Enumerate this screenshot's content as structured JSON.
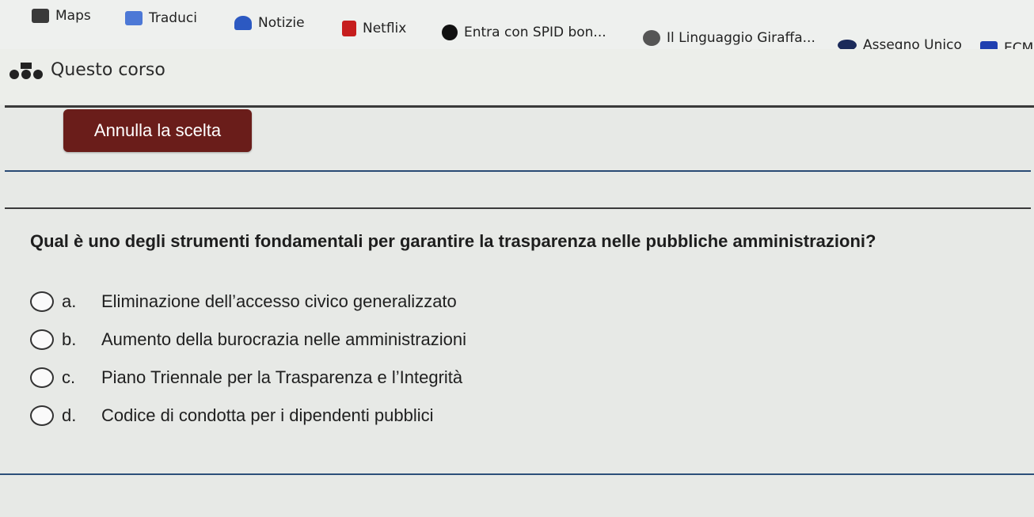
{
  "bookmarks": [
    {
      "label": "Maps",
      "icon": "maps-icon",
      "color": "#3a3a3a"
    },
    {
      "label": "Traduci",
      "icon": "translate-icon",
      "color": "#4c78d6"
    },
    {
      "label": "Notizie",
      "icon": "news-icon",
      "color": "#2c59c2"
    },
    {
      "label": "Netflix",
      "icon": "netflix-icon",
      "color": "#c61d1d"
    },
    {
      "label": "Entra con SPID bon...",
      "icon": "spid-icon",
      "color": "#111111"
    },
    {
      "label": "Il Linguaggio Giraffa...",
      "icon": "giraffe-icon",
      "color": "#555555"
    },
    {
      "label": "Assegno Unico",
      "icon": "assegno-icon",
      "color": "#1b2a5a"
    },
    {
      "label": "ECM",
      "icon": "ecm-icon",
      "color": "#1f3fb0"
    }
  ],
  "course": {
    "label": "Questo corso",
    "icon": "course-icon"
  },
  "cancel_button": {
    "label": "Annulla la scelta",
    "color": "#6a1d1a"
  },
  "question": {
    "text": "Qual è uno degli strumenti fondamentali per garantire la trasparenza nelle pubbliche amministrazioni?",
    "options": [
      {
        "letter": "a.",
        "text": "Eliminazione dell’accesso civico generalizzato"
      },
      {
        "letter": "b.",
        "text": "Aumento della burocrazia nelle amministrazioni"
      },
      {
        "letter": "c.",
        "text": "Piano Triennale per la Trasparenza e l’Integrità"
      },
      {
        "letter": "d.",
        "text": "Codice di condotta per i dipendenti pubblici"
      }
    ]
  }
}
